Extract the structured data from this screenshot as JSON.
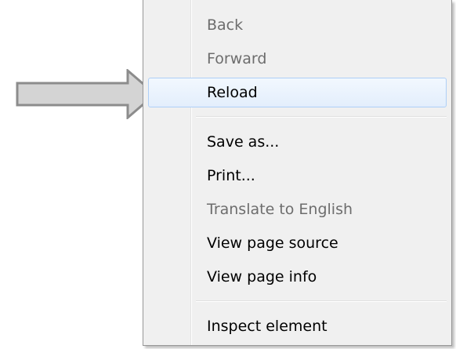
{
  "menu": {
    "items": [
      {
        "label": "Back",
        "enabled": false
      },
      {
        "label": "Forward",
        "enabled": false
      },
      {
        "label": "Reload",
        "enabled": true,
        "highlighted": true
      },
      {
        "label": "Save as...",
        "enabled": true
      },
      {
        "label": "Print...",
        "enabled": true
      },
      {
        "label": "Translate to English",
        "enabled": false
      },
      {
        "label": "View page source",
        "enabled": true
      },
      {
        "label": "View page info",
        "enabled": true
      },
      {
        "label": "Inspect element",
        "enabled": true
      }
    ]
  },
  "colors": {
    "menu_background": "#f0f0f0",
    "menu_border": "#979797",
    "highlight_border": "#aecff7",
    "highlight_fill": "#e3eefc",
    "disabled_text": "#6d6d6d",
    "arrow_fill": "#d4d4d4",
    "arrow_stroke": "#8c8c8c"
  },
  "icons": {
    "pointer_arrow": "right-arrow-icon"
  }
}
